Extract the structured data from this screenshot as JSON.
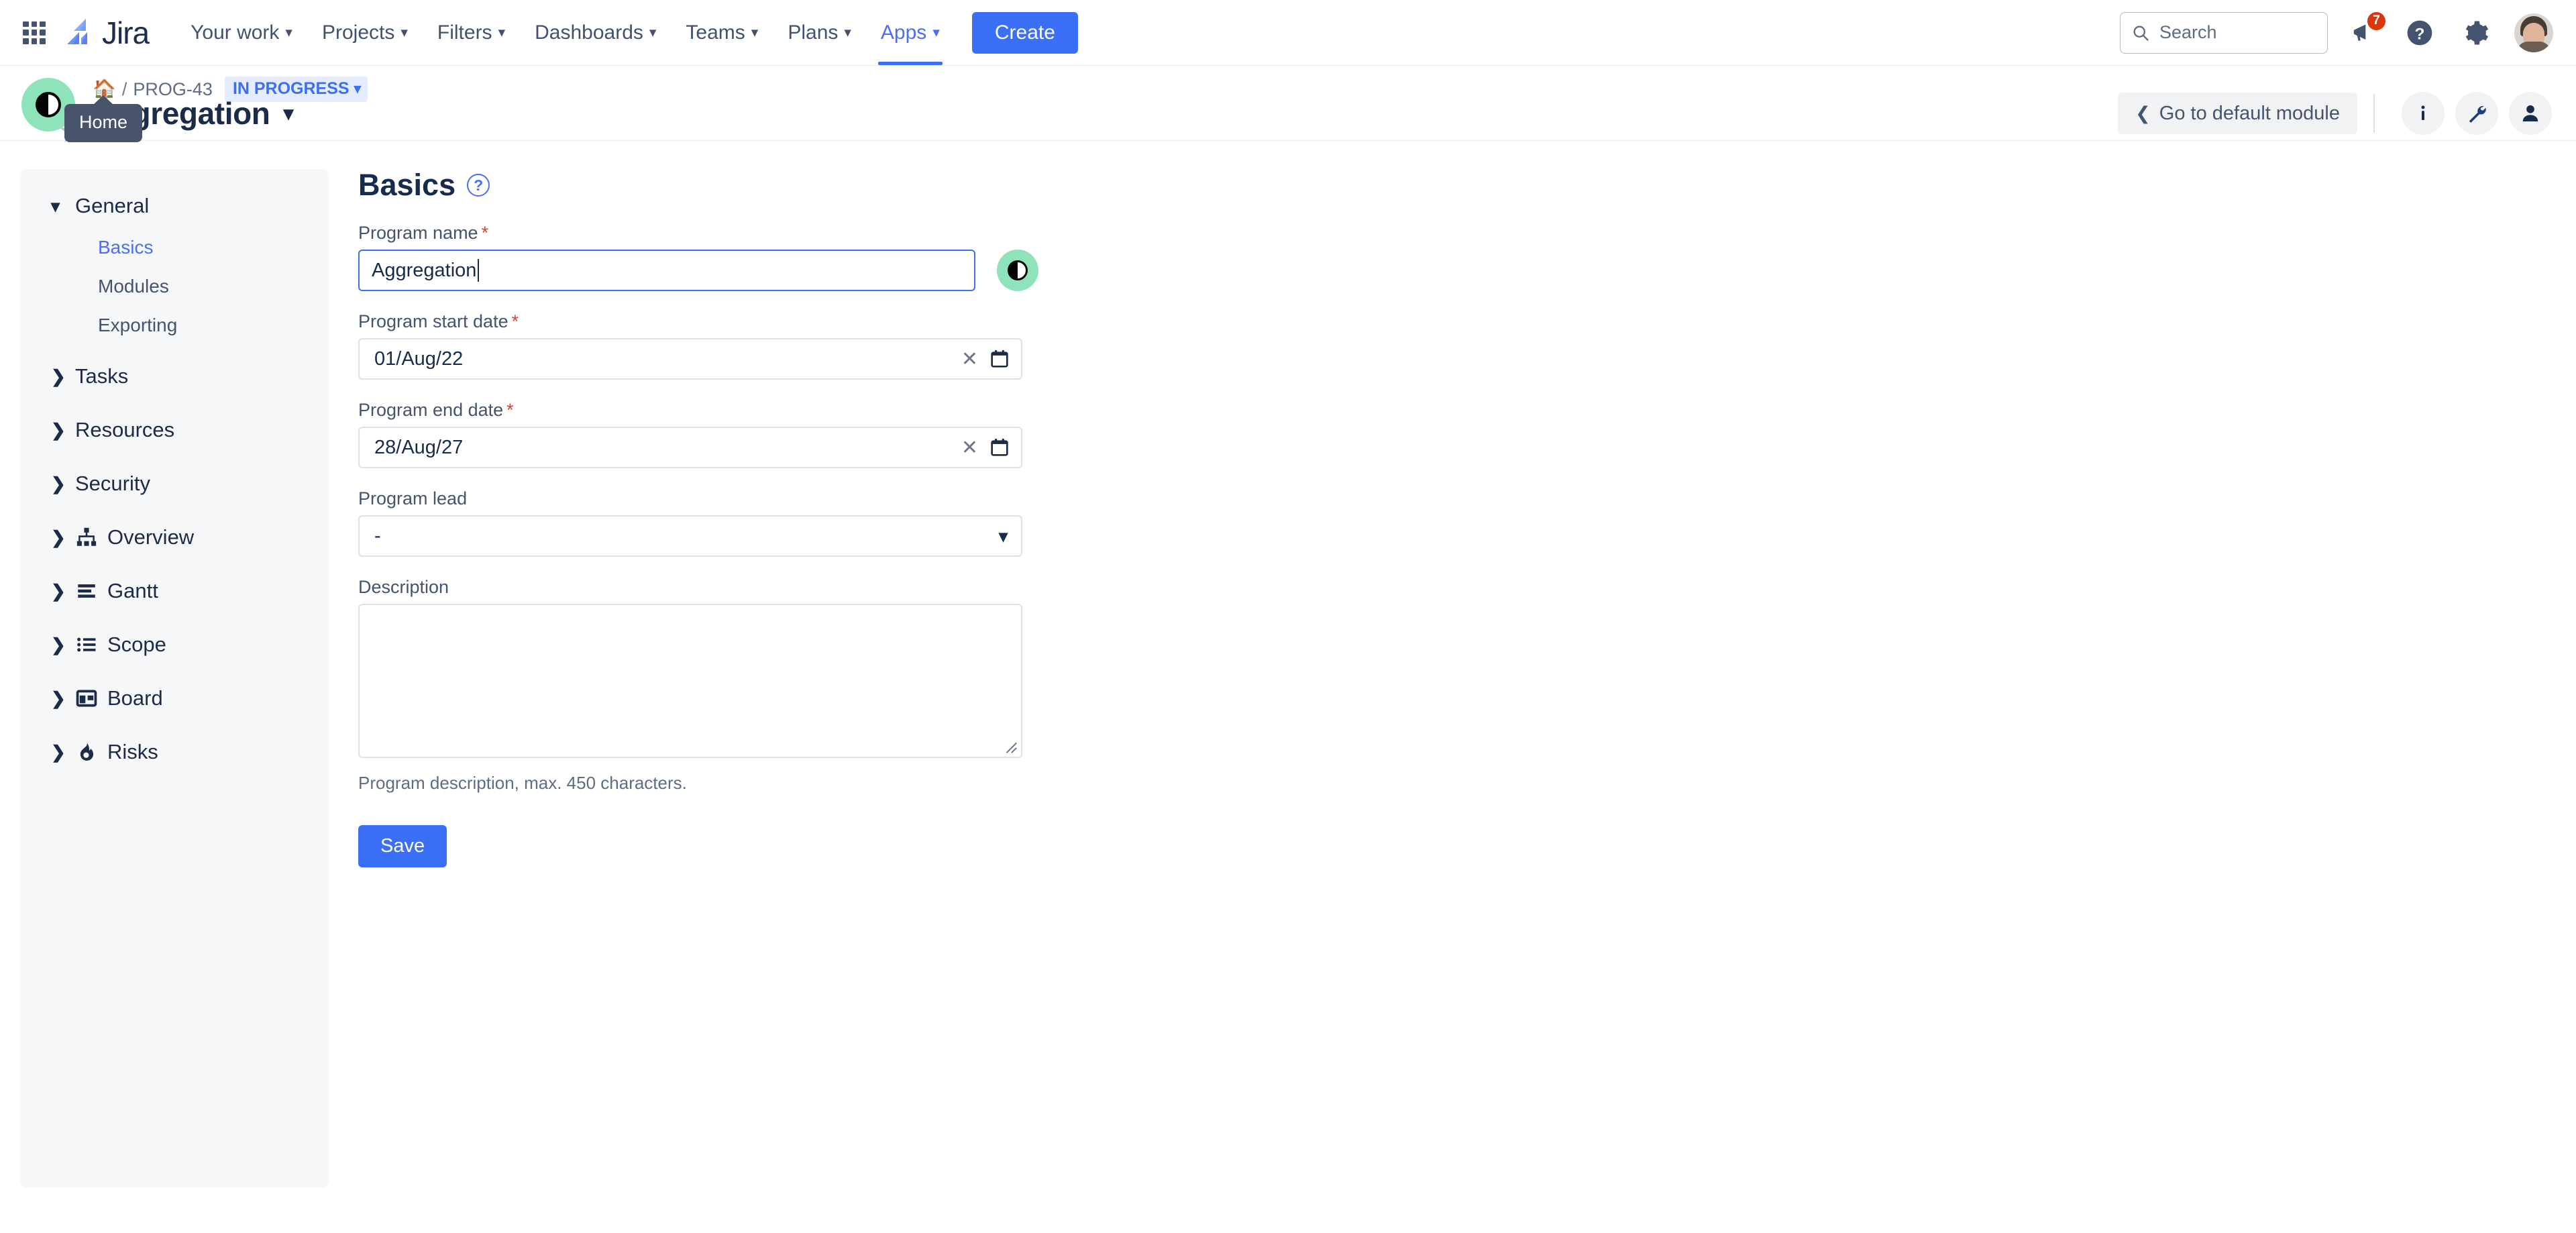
{
  "topnav": {
    "logo_text": "Jira",
    "items": [
      {
        "label": "Your work",
        "active": false
      },
      {
        "label": "Projects",
        "active": false
      },
      {
        "label": "Filters",
        "active": false
      },
      {
        "label": "Dashboards",
        "active": false
      },
      {
        "label": "Teams",
        "active": false
      },
      {
        "label": "Plans",
        "active": false
      },
      {
        "label": "Apps",
        "active": true
      }
    ],
    "create_label": "Create",
    "search_placeholder": "Search",
    "notifications_count": "7"
  },
  "pageheader": {
    "breadcrumb_key": "PROG-43",
    "breadcrumb_separator": "/",
    "status": "IN PROGRESS",
    "title": "Aggregation",
    "tooltip": "Home",
    "default_module_label": "Go to default module"
  },
  "sidebar": {
    "groups": [
      {
        "label": "General",
        "expanded": true,
        "children": [
          {
            "label": "Basics",
            "active": true
          },
          {
            "label": "Modules",
            "active": false
          },
          {
            "label": "Exporting",
            "active": false
          }
        ]
      },
      {
        "label": "Tasks",
        "expanded": false,
        "children": []
      },
      {
        "label": "Resources",
        "expanded": false,
        "children": []
      },
      {
        "label": "Security",
        "expanded": false,
        "children": []
      },
      {
        "label": "Overview",
        "expanded": false,
        "icon": "sitemap-icon",
        "children": []
      },
      {
        "label": "Gantt",
        "expanded": false,
        "icon": "bars-icon",
        "children": []
      },
      {
        "label": "Scope",
        "expanded": false,
        "icon": "list-icon",
        "children": []
      },
      {
        "label": "Board",
        "expanded": false,
        "icon": "board-icon",
        "children": []
      },
      {
        "label": "Risks",
        "expanded": false,
        "icon": "fire-icon",
        "children": []
      }
    ]
  },
  "form": {
    "section_title": "Basics",
    "program_name": {
      "label": "Program name",
      "required": true,
      "value": "Aggregation"
    },
    "start_date": {
      "label": "Program start date",
      "required": true,
      "value": "01/Aug/22"
    },
    "end_date": {
      "label": "Program end date",
      "required": true,
      "value": "28/Aug/27"
    },
    "program_lead": {
      "label": "Program lead",
      "required": false,
      "value": "-"
    },
    "description": {
      "label": "Description",
      "required": false,
      "value": ""
    },
    "helper_text": "Program description, max. 450 characters.",
    "save_label": "Save"
  },
  "colors": {
    "brand_blue": "#3b6ff5",
    "link_blue": "#4c6ef5",
    "text_dark": "#172b4d",
    "text_muted": "#44546f",
    "sidebar_bg": "#f6f7f9",
    "badge_red": "#de350b",
    "avatar_green": "#8fe3bb",
    "tooltip_bg": "#48546b",
    "required_red": "#d04437"
  }
}
